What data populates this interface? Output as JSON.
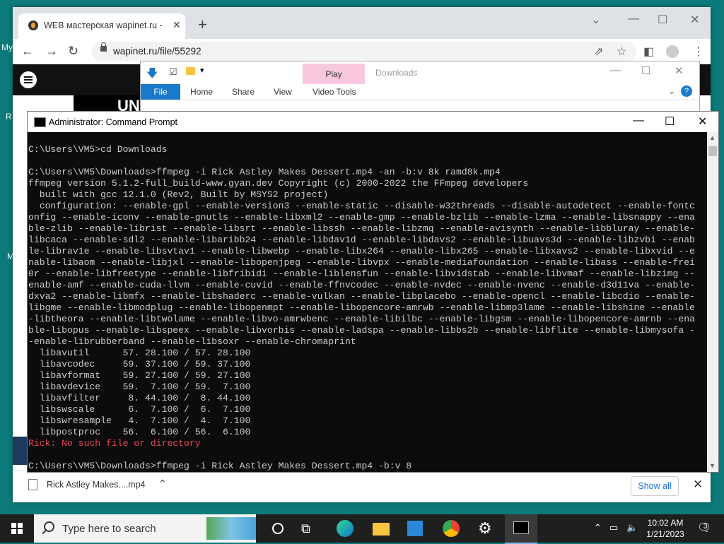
{
  "desktop": {
    "labels": [
      "My",
      "R",
      "M"
    ]
  },
  "chrome": {
    "tab_title": "WEB мастерская wapinet.ru - Rick",
    "url": "wapinet.ru/file/55292",
    "banner_text": "UN",
    "download": {
      "filename": "Rick Astley Makes....mp4",
      "show_all": "Show all"
    }
  },
  "explorer": {
    "title": "Downloads",
    "play_tab": "Play",
    "ribbon_tabs": [
      "File",
      "Home",
      "Share",
      "View",
      "Video Tools"
    ]
  },
  "cmd": {
    "title": "Administrator: Command Prompt",
    "lines": [
      {
        "text": "C:\\Users\\VM5>cd Downloads",
        "type": "normal"
      },
      {
        "text": "",
        "type": "normal"
      },
      {
        "text": "C:\\Users\\VM5\\Downloads>ffmpeg -i Rick Astley Makes Dessert.mp4 -an -b:v 8k ramd8k.mp4",
        "type": "normal"
      },
      {
        "text": "ffmpeg version 5.1.2-full_build-www.gyan.dev Copyright (c) 2000-2022 the FFmpeg developers",
        "type": "normal"
      },
      {
        "text": "  built with gcc 12.1.0 (Rev2, Built by MSYS2 project)",
        "type": "normal"
      },
      {
        "text": "  configuration: --enable-gpl --enable-version3 --enable-static --disable-w32threads --disable-autodetect --enable-fontc",
        "type": "normal"
      },
      {
        "text": "onfig --enable-iconv --enable-gnutls --enable-libxml2 --enable-gmp --enable-bzlib --enable-lzma --enable-libsnappy --ena",
        "type": "normal"
      },
      {
        "text": "ble-zlib --enable-librist --enable-libsrt --enable-libssh --enable-libzmq --enable-avisynth --enable-libbluray --enable-",
        "type": "normal"
      },
      {
        "text": "libcaca --enable-sdl2 --enable-libaribb24 --enable-libdav1d --enable-libdavs2 --enable-libuavs3d --enable-libzvbi --enab",
        "type": "normal"
      },
      {
        "text": "le-librav1e --enable-libsvtav1 --enable-libwebp --enable-libx264 --enable-libx265 --enable-libxavs2 --enable-libxvid --e",
        "type": "normal"
      },
      {
        "text": "nable-libaom --enable-libjxl --enable-libopenjpeg --enable-libvpx --enable-mediafoundation --enable-libass --enable-frei",
        "type": "normal"
      },
      {
        "text": "0r --enable-libfreetype --enable-libfribidi --enable-liblensfun --enable-libvidstab --enable-libvmaf --enable-libzimg --",
        "type": "normal"
      },
      {
        "text": "enable-amf --enable-cuda-llvm --enable-cuvid --enable-ffnvcodec --enable-nvdec --enable-nvenc --enable-d3d11va --enable-",
        "type": "normal"
      },
      {
        "text": "dxva2 --enable-libmfx --enable-libshaderc --enable-vulkan --enable-libplacebo --enable-opencl --enable-libcdio --enable-",
        "type": "normal"
      },
      {
        "text": "libgme --enable-libmodplug --enable-libopenmpt --enable-libopencore-amrwb --enable-libmp3lame --enable-libshine --enable",
        "type": "normal"
      },
      {
        "text": "-libtheora --enable-libtwolame --enable-libvo-amrwbenc --enable-libilbc --enable-libgsm --enable-libopencore-amrnb --ena",
        "type": "normal"
      },
      {
        "text": "ble-libopus --enable-libspeex --enable-libvorbis --enable-ladspa --enable-libbs2b --enable-libflite --enable-libmysofa -",
        "type": "normal"
      },
      {
        "text": "-enable-librubberband --enable-libsoxr --enable-chromaprint",
        "type": "normal"
      },
      {
        "text": "  libavutil      57. 28.100 / 57. 28.100",
        "type": "normal"
      },
      {
        "text": "  libavcodec     59. 37.100 / 59. 37.100",
        "type": "normal"
      },
      {
        "text": "  libavformat    59. 27.100 / 59. 27.100",
        "type": "normal"
      },
      {
        "text": "  libavdevice    59.  7.100 / 59.  7.100",
        "type": "normal"
      },
      {
        "text": "  libavfilter     8. 44.100 /  8. 44.100",
        "type": "normal"
      },
      {
        "text": "  libswscale      6.  7.100 /  6.  7.100",
        "type": "normal"
      },
      {
        "text": "  libswresample   4.  7.100 /  4.  7.100",
        "type": "normal"
      },
      {
        "text": "  libpostproc    56.  6.100 / 56.  6.100",
        "type": "normal"
      },
      {
        "text": "Rick: No such file or directory",
        "type": "error"
      },
      {
        "text": "",
        "type": "normal"
      },
      {
        "text": "C:\\Users\\VM5\\Downloads>ffmpeg -i Rick Astley Makes Dessert.mp4 -b:v 8",
        "type": "normal"
      }
    ]
  },
  "taskbar": {
    "search_placeholder": "Type here to search",
    "time": "10:02 AM",
    "date": "1/21/2023",
    "notification_count": "3"
  },
  "colors": {
    "cmd_bg": "#0c0c0c",
    "cmd_text": "#cccccc",
    "cmd_error": "#e74856",
    "accent": "#1979ca"
  }
}
